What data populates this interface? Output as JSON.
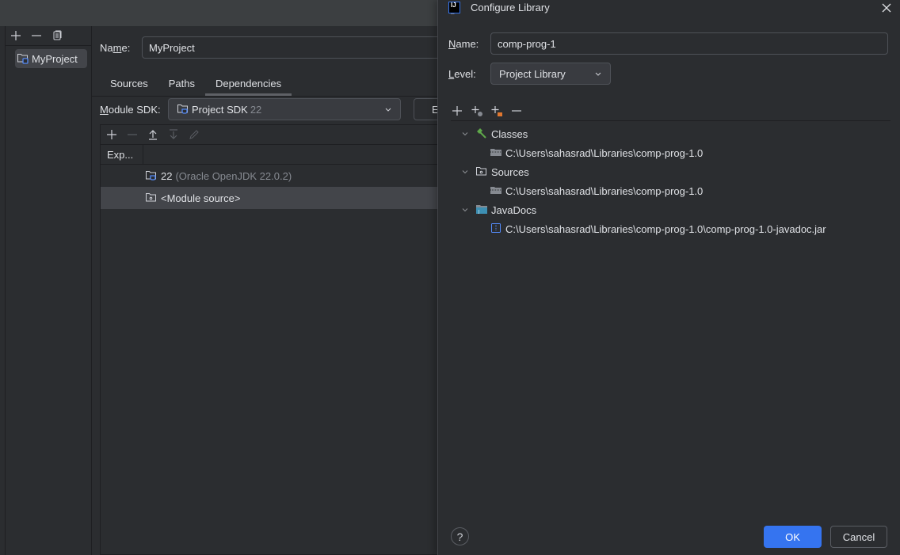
{
  "project_panel": {
    "toolbar": [
      "add",
      "remove",
      "copy"
    ],
    "items": [
      {
        "label": "MyProject",
        "icon": "module-folder-icon",
        "selected": true
      }
    ]
  },
  "module": {
    "name_label": "Name:",
    "name_label_mnemonic": "m",
    "name_value": "MyProject",
    "tabs": [
      {
        "label": "Sources",
        "active": false
      },
      {
        "label": "Paths",
        "active": false
      },
      {
        "label": "Dependencies",
        "active": true
      }
    ],
    "sdk_label": "Module SDK:",
    "sdk_value": "Project SDK",
    "sdk_version": "22",
    "partial_button_label": "E",
    "dependencies": {
      "column_header": "Exp...",
      "rows": [
        {
          "name": "22",
          "detail": "(Oracle OpenJDK 22.0.2)",
          "icon": "jdk-folder-icon",
          "selected": false
        },
        {
          "name": "<Module source>",
          "detail": "",
          "icon": "source-folder-icon",
          "selected": true
        }
      ]
    }
  },
  "dialog": {
    "title": "Configure Library",
    "name_label": "Name:",
    "name_value": "comp-prog-1",
    "level_label": "Level:",
    "level_value": "Project Library",
    "tree": [
      {
        "label": "Classes",
        "icon": "hammer-icon",
        "children": [
          "C:\\Users\\sahasrad\\Libraries\\comp-prog-1.0"
        ]
      },
      {
        "label": "Sources",
        "icon": "source-folder-icon",
        "children": [
          "C:\\Users\\sahasrad\\Libraries\\comp-prog-1.0"
        ]
      },
      {
        "label": "JavaDocs",
        "icon": "javadoc-folder-icon",
        "children": [
          "C:\\Users\\sahasrad\\Libraries\\comp-prog-1.0\\comp-prog-1.0-javadoc.jar"
        ]
      }
    ],
    "help_label": "?",
    "ok_label": "OK",
    "cancel_label": "Cancel",
    "colors": {
      "accent": "#3574f0",
      "hammer": "#5fa84a",
      "archive": "#e0772f"
    }
  }
}
